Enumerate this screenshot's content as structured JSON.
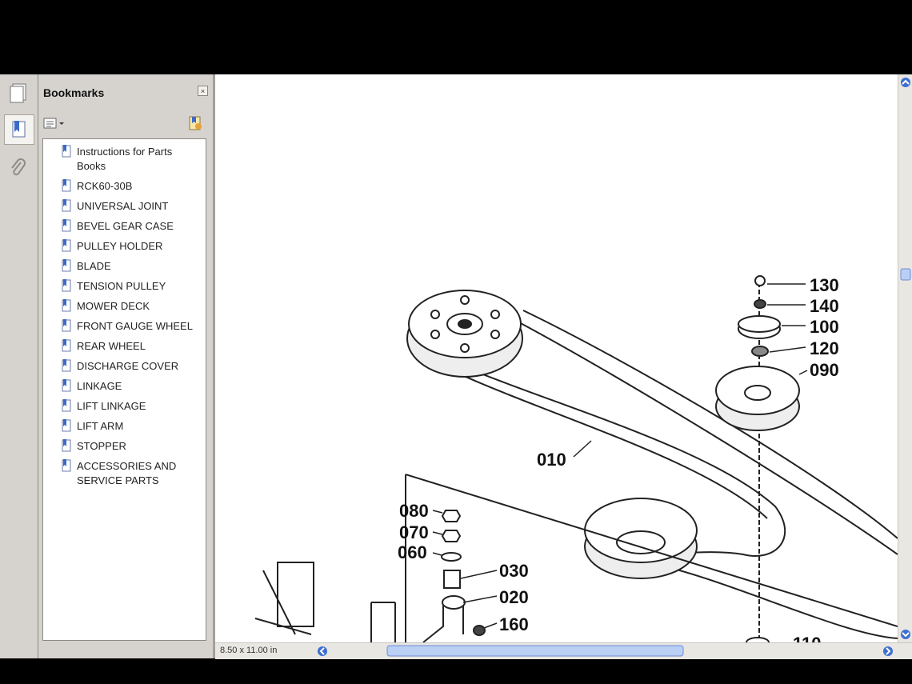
{
  "panel": {
    "title": "Bookmarks",
    "close_glyph": "×",
    "bookmarks": [
      {
        "label": "Instructions for Parts Books"
      },
      {
        "label": "RCK60-30B"
      },
      {
        "label": "UNIVERSAL JOINT"
      },
      {
        "label": "BEVEL GEAR CASE"
      },
      {
        "label": "PULLEY HOLDER"
      },
      {
        "label": "BLADE"
      },
      {
        "label": "TENSION PULLEY"
      },
      {
        "label": "MOWER DECK"
      },
      {
        "label": "FRONT GAUGE WHEEL"
      },
      {
        "label": "REAR WHEEL"
      },
      {
        "label": "DISCHARGE COVER"
      },
      {
        "label": "LINKAGE"
      },
      {
        "label": "LIFT LINKAGE"
      },
      {
        "label": "LIFT ARM"
      },
      {
        "label": "STOPPER"
      },
      {
        "label": "ACCESSORIES AND SERVICE PARTS"
      }
    ]
  },
  "status": {
    "page_size": "8.50 x 11.00 in"
  },
  "diagram": {
    "callouts": [
      "130",
      "140",
      "100",
      "120",
      "090",
      "010",
      "080",
      "070",
      "060",
      "030",
      "020",
      "160",
      "110"
    ]
  },
  "icons": {
    "rail": [
      "pages-icon",
      "bookmarks-icon",
      "attachments-icon"
    ]
  },
  "colors": {
    "panel_bg": "#d6d3ce",
    "scroll_arrow": "#3c6fd1"
  }
}
